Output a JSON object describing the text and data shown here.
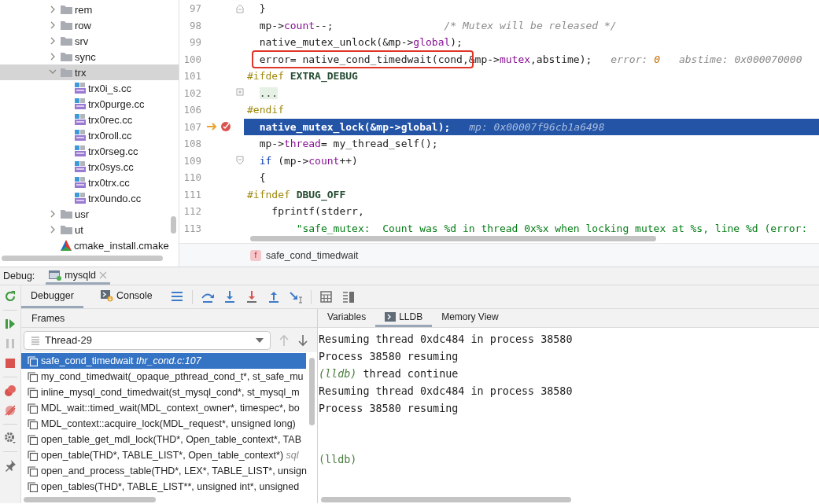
{
  "project_tree": {
    "items": [
      {
        "kind": "folder",
        "label": "rem",
        "expanded": false,
        "selected": false
      },
      {
        "kind": "folder",
        "label": "row",
        "expanded": false,
        "selected": false
      },
      {
        "kind": "folder",
        "label": "srv",
        "expanded": false,
        "selected": false
      },
      {
        "kind": "folder",
        "label": "sync",
        "expanded": false,
        "selected": false
      },
      {
        "kind": "folder",
        "label": "trx",
        "expanded": true,
        "selected": true,
        "children": [
          {
            "kind": "cpp",
            "label": "trx0i_s.cc",
            "selected": false
          },
          {
            "kind": "cpp",
            "label": "trx0purge.cc",
            "selected": false
          },
          {
            "kind": "cpp",
            "label": "trx0rec.cc",
            "selected": false
          },
          {
            "kind": "cpp",
            "label": "trx0roll.cc",
            "selected": false
          },
          {
            "kind": "cpp",
            "label": "trx0rseg.cc",
            "selected": false
          },
          {
            "kind": "cpp",
            "label": "trx0sys.cc",
            "selected": false
          },
          {
            "kind": "cpp",
            "label": "trx0trx.cc",
            "selected": false
          },
          {
            "kind": "cpp",
            "label": "trx0undo.cc",
            "selected": false
          }
        ]
      },
      {
        "kind": "folder",
        "label": "usr",
        "expanded": false,
        "selected": false
      },
      {
        "kind": "folder",
        "label": "ut",
        "expanded": false,
        "selected": false
      },
      {
        "kind": "cmake",
        "label": "cmake_install.cmake",
        "selected": false
      }
    ]
  },
  "editor": {
    "lines": [
      {
        "number": "97",
        "current": false,
        "breakpoint": false,
        "fold": {
          "kind": "end"
        },
        "segments": [
          {
            "kind": "plain",
            "text": "  }"
          }
        ]
      },
      {
        "number": "98",
        "current": false,
        "breakpoint": false,
        "segments": [
          {
            "kind": "plain",
            "text": "  mp->"
          },
          {
            "kind": "field",
            "text": "count"
          },
          {
            "kind": "plain",
            "text": "--;                  "
          },
          {
            "kind": "comment",
            "text": "/* Mutex will be released */"
          }
        ]
      },
      {
        "number": "99",
        "current": false,
        "breakpoint": false,
        "segments": [
          {
            "kind": "plain",
            "text": "  native_mutex_unlock(&mp->"
          },
          {
            "kind": "field",
            "text": "global"
          },
          {
            "kind": "plain",
            "text": ");"
          }
        ]
      },
      {
        "number": "100",
        "current": false,
        "breakpoint": false,
        "segments": [
          {
            "kind": "boxed",
            "text": "  error= native_cond_timedwait(cond,"
          },
          {
            "kind": "plain",
            "text": "&mp->"
          },
          {
            "kind": "field",
            "text": "mutex"
          },
          {
            "kind": "plain",
            "text": ",abstime);"
          }
        ],
        "hints": [
          {
            "name": "error:",
            "value": "0",
            "kind": "number"
          },
          {
            "name": "abstime:",
            "value": "0x000070000",
            "kind": "address"
          }
        ]
      },
      {
        "number": "101",
        "current": false,
        "breakpoint": false,
        "segments": [
          {
            "kind": "macro",
            "text": "#ifdef"
          },
          {
            "kind": "macro_name",
            "text": " EXTRA_DEBUG"
          }
        ]
      },
      {
        "number": "102",
        "current": false,
        "breakpoint": false,
        "fold": {
          "kind": "collapsed"
        },
        "segments": [
          {
            "kind": "folded",
            "text": "  ..."
          }
        ]
      },
      {
        "number": "106",
        "current": false,
        "breakpoint": false,
        "segments": [
          {
            "kind": "macro",
            "text": "#endif"
          }
        ]
      },
      {
        "number": "107",
        "current": true,
        "breakpoint": true,
        "segments": [
          {
            "kind": "plain",
            "text": "  native_mutex_lock(&mp->"
          },
          {
            "kind": "field",
            "text": "global"
          },
          {
            "kind": "plain",
            "text": ");"
          }
        ],
        "hints": [
          {
            "name": "mp:",
            "value": "0x00007f96cb1a6498",
            "kind": "address"
          }
        ]
      },
      {
        "number": "108",
        "current": false,
        "breakpoint": false,
        "segments": [
          {
            "kind": "plain",
            "text": "  mp->"
          },
          {
            "kind": "field",
            "text": "thread"
          },
          {
            "kind": "plain",
            "text": "= my_thread_self();"
          }
        ]
      },
      {
        "number": "109",
        "current": false,
        "breakpoint": false,
        "fold": {
          "kind": "start"
        },
        "segments": [
          {
            "kind": "keyword",
            "text": "  if"
          },
          {
            "kind": "plain",
            "text": " (mp->"
          },
          {
            "kind": "field",
            "text": "count"
          },
          {
            "kind": "plain",
            "text": "++)"
          }
        ]
      },
      {
        "number": "110",
        "current": false,
        "breakpoint": false,
        "segments": [
          {
            "kind": "plain",
            "text": "  {"
          }
        ]
      },
      {
        "number": "111",
        "current": false,
        "breakpoint": false,
        "segments": [
          {
            "kind": "macro",
            "text": "#ifndef"
          },
          {
            "kind": "macro_name",
            "text": " DBUG_OFF"
          }
        ]
      },
      {
        "number": "112",
        "current": false,
        "breakpoint": false,
        "segments": [
          {
            "kind": "plain",
            "text": "    fprintf(stderr,"
          }
        ]
      },
      {
        "number": "113",
        "current": false,
        "breakpoint": false,
        "segments": [
          {
            "kind": "string",
            "text": "        \"safe_mutex:  Count was %d in thread 0x%x when locking mutex at %s, line %d (error:"
          }
        ]
      }
    ],
    "breadcrumb": {
      "badge": "f",
      "label": "safe_cond_timedwait"
    }
  },
  "debug": {
    "label": "Debug:",
    "session_tab": {
      "label": "mysqld",
      "selected": true
    },
    "tabs": [
      {
        "label": "Debugger",
        "selected": true
      },
      {
        "label": "Console",
        "selected": false
      }
    ],
    "frames": {
      "title": "Frames",
      "thread": "Thread-29",
      "items": [
        {
          "name": "safe_cond_timedwait",
          "location": "thr_cond.c:107",
          "selected": true
        },
        {
          "name": "my_cond_timedwait(_opaque_pthread_cond_t*, st_safe_mu",
          "selected": false
        },
        {
          "name": "inline_mysql_cond_timedwait(st_mysql_cond*, st_mysql_m",
          "selected": false
        },
        {
          "name": "MDL_wait::timed_wait(MDL_context_owner*, timespec*, bo",
          "selected": false
        },
        {
          "name": "MDL_context::acquire_lock(MDL_request*, unsigned long)",
          "selected": false
        },
        {
          "name": "open_table_get_mdl_lock(THD*, Open_table_context*, TAB",
          "selected": false
        },
        {
          "name": "open_table(THD*, TABLE_LIST*, Open_table_context*)",
          "location": "sql",
          "selected": false
        },
        {
          "name": "open_and_process_table(THD*, LEX*, TABLE_LIST*, unsign",
          "selected": false
        },
        {
          "name": "open_tables(THD*, TABLE_LIST**, unsigned int*, unsigned",
          "selected": false
        }
      ]
    },
    "console": {
      "tabs": [
        {
          "label": "Variables",
          "selected": false
        },
        {
          "label": "LLDB",
          "selected": true
        },
        {
          "label": "Memory View",
          "selected": false
        }
      ],
      "lines": [
        {
          "kind": "output",
          "text": "Resuming thread 0xdc484 in process 38580"
        },
        {
          "kind": "output",
          "text": "Process 38580 resuming"
        },
        {
          "kind": "command",
          "prompt": "(lldb)",
          "text": "thread continue"
        },
        {
          "kind": "output",
          "text": "Resuming thread 0xdc484 in process 38580"
        },
        {
          "kind": "output",
          "text": "Process 38580 resuming"
        }
      ],
      "prompt": "(lldb)"
    }
  }
}
